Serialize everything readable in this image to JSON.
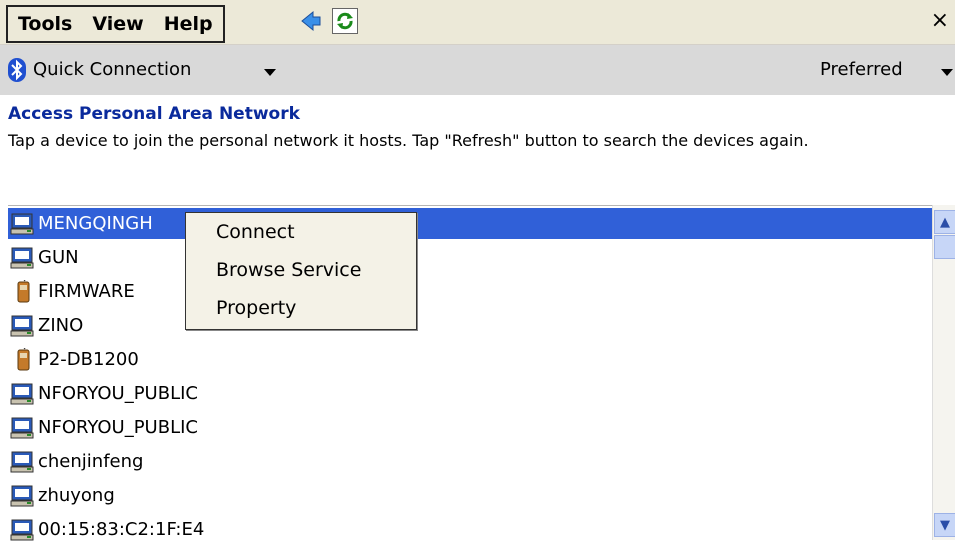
{
  "menubar": {
    "menus": [
      "Tools",
      "View",
      "Help"
    ],
    "close_label": "×"
  },
  "connbar": {
    "quick_connection_label": "Quick Connection",
    "preferred_label": "Preferred"
  },
  "section": {
    "title": "Access Personal Area Network",
    "description": "Tap a device to join the personal network it hosts. Tap \"Refresh\" button to search the devices again."
  },
  "devices": [
    {
      "name": "MENGQINGH",
      "icon": "computer-icon",
      "selected": true
    },
    {
      "name": "GUN",
      "icon": "computer-icon"
    },
    {
      "name": "FIRMWARE",
      "icon": "phone-icon"
    },
    {
      "name": "ZINO",
      "icon": "computer-icon"
    },
    {
      "name": "P2-DB1200",
      "icon": "phone-icon"
    },
    {
      "name": "NFORYOU_PUBLIC",
      "icon": "computer-icon"
    },
    {
      "name": "NFORYOU_PUBLIC",
      "icon": "computer-icon"
    },
    {
      "name": "chenjinfeng",
      "icon": "computer-icon"
    },
    {
      "name": "zhuyong",
      "icon": "computer-icon"
    },
    {
      "name": "00:15:83:C2:1F:E4",
      "icon": "computer-icon"
    }
  ],
  "context_menu": [
    "Connect",
    "Browse Service",
    "Property"
  ],
  "colors": {
    "selection": "#3060d8",
    "title_blue": "#0a2a9c",
    "bluetooth": "#1f4fd0"
  }
}
